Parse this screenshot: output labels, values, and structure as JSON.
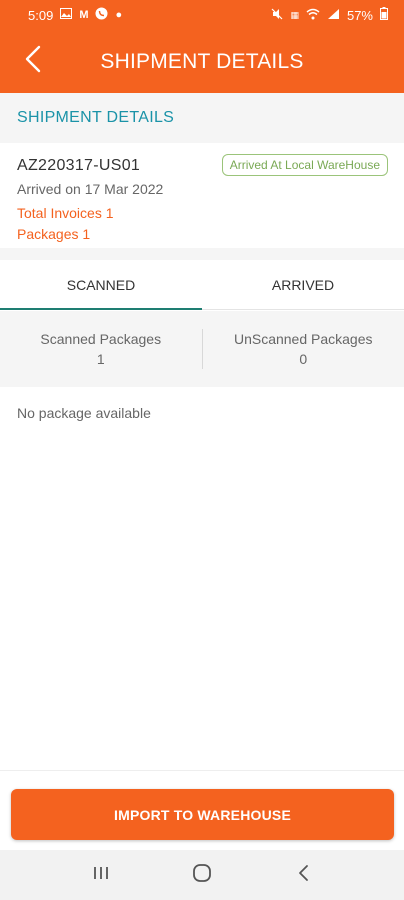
{
  "status_bar": {
    "time": "5:09",
    "battery": "57%",
    "left_icons": [
      "gallery-icon",
      "m-icon",
      "whatsapp-icon",
      "dot-icon"
    ],
    "right_icons": [
      "mute-icon",
      "volte-icon",
      "wifi-icon",
      "signal-icon",
      "battery-icon"
    ]
  },
  "header": {
    "title": "SHIPMENT DETAILS",
    "back_icon": "chevron-left-icon"
  },
  "section": {
    "title": "SHIPMENT DETAILS"
  },
  "shipment": {
    "id": "AZ220317-US01",
    "arrived_on": "Arrived on 17 Mar 2022",
    "status": "Arrived At Local WareHouse",
    "total_invoices": "Total Invoices 1",
    "packages": "Packages 1"
  },
  "tabs": [
    {
      "label": "SCANNED",
      "active": true
    },
    {
      "label": "ARRIVED",
      "active": false
    }
  ],
  "counters": {
    "scanned_label": "Scanned Packages",
    "scanned_value": "1",
    "unscanned_label": "UnScanned Packages",
    "unscanned_value": "0"
  },
  "empty_state": "No package available",
  "actions": {
    "import_label": "IMPORT TO WAREHOUSE"
  },
  "colors": {
    "primary": "#f4621f",
    "teal": "#1a93a8",
    "badge_green": "#7aa955"
  },
  "nav_bar": {
    "icons": [
      "recent-apps-icon",
      "home-icon",
      "back-icon"
    ]
  }
}
